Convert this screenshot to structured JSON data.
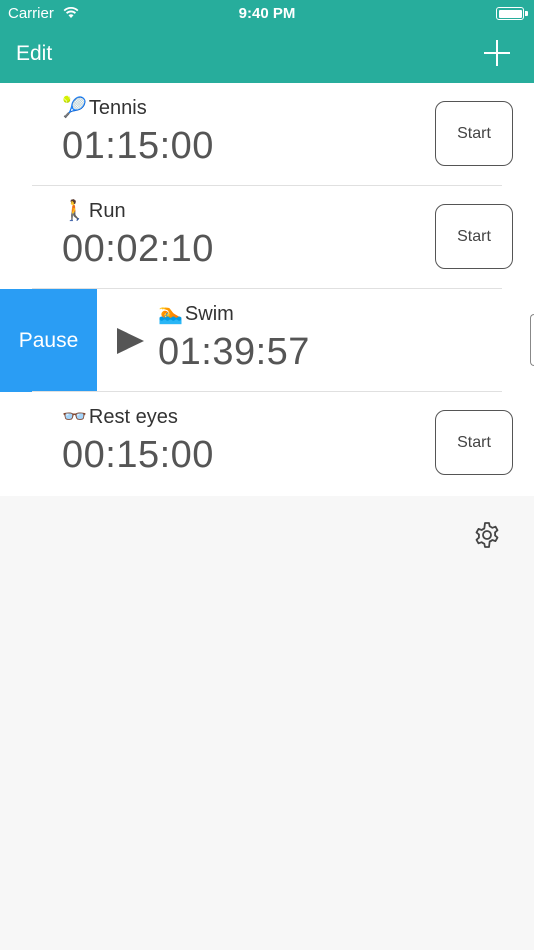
{
  "status_bar": {
    "carrier": "Carrier",
    "time": "9:40 PM"
  },
  "nav": {
    "edit_label": "Edit",
    "add_icon": "plus-icon"
  },
  "timers": [
    {
      "emoji": "🎾",
      "name": "Tennis",
      "time": "01:15:00",
      "action": "Start"
    },
    {
      "emoji": "🚶",
      "name": "Run",
      "time": "00:02:10",
      "action": "Start"
    },
    {
      "emoji": "🏊",
      "name": "Swim",
      "time": "01:39:57",
      "action": "Pause"
    },
    {
      "emoji": "👓",
      "name": "Rest eyes",
      "time": "00:15:00",
      "action": "Start"
    }
  ],
  "colors": {
    "header": "#27ad9c",
    "pause": "#2a9df4",
    "background": "#f7f7f7"
  },
  "settings_icon": "gear-icon"
}
